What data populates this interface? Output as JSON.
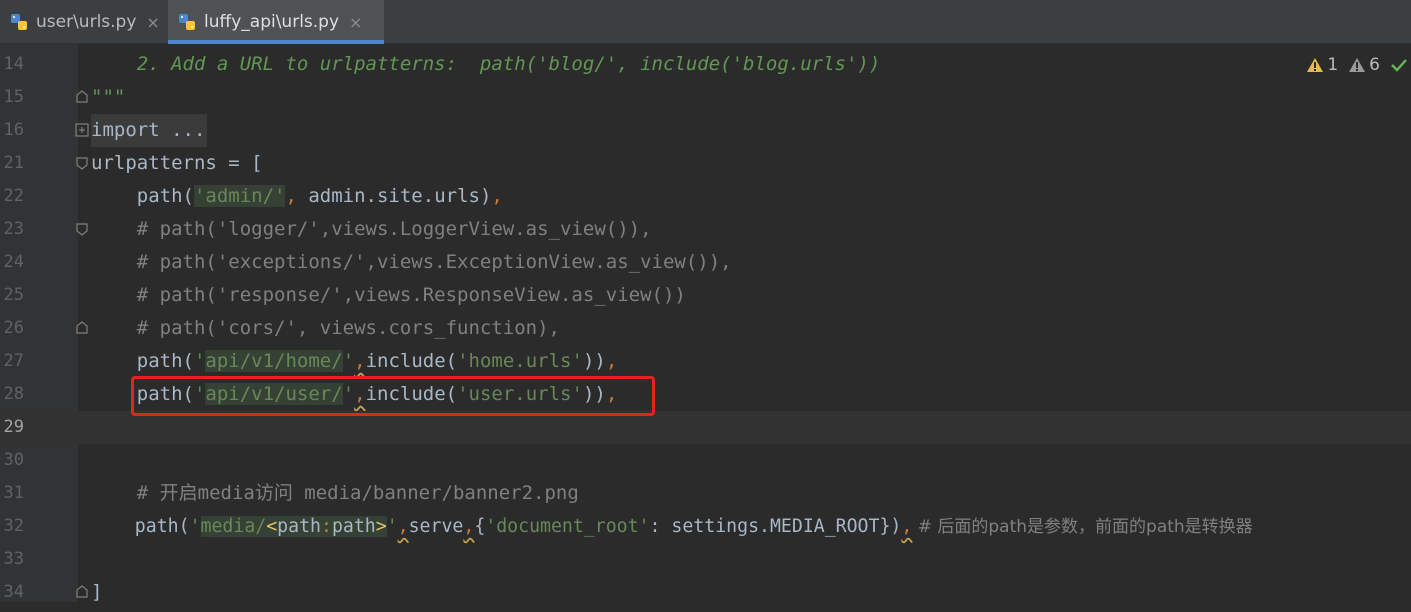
{
  "tabs": [
    {
      "label": "user\\urls.py",
      "close": "×",
      "active": false,
      "icon": "python-file-icon"
    },
    {
      "label": "luffy_api\\urls.py",
      "close": "×",
      "active": true,
      "icon": "python-file-icon"
    }
  ],
  "inspections": {
    "errors": "1",
    "warnings": "6"
  },
  "lines": [
    {
      "n": "14",
      "parts": [
        "    2. Add a URL to urlpatterns:  path('blog/', include('blog.urls'))"
      ]
    },
    {
      "n": "15",
      "parts": [
        "\"\"\""
      ]
    },
    {
      "n": "16",
      "parts": [
        "import",
        " ..."
      ]
    },
    {
      "n": "21",
      "parts": [
        "urlpatterns = ["
      ]
    },
    {
      "n": "22",
      "parts": [
        "    path(",
        "'admin/'",
        ", ",
        "admin.site.urls)",
        ","
      ]
    },
    {
      "n": "23",
      "parts": [
        "    # path('logger/',views.LoggerView.as_view()),"
      ]
    },
    {
      "n": "24",
      "parts": [
        "    # path('exceptions/',views.ExceptionView.as_view()),"
      ]
    },
    {
      "n": "25",
      "parts": [
        "    # path('response/',views.ResponseView.as_view())"
      ]
    },
    {
      "n": "26",
      "parts": [
        "    # path('cors/', views.cors_function),"
      ]
    },
    {
      "n": "27",
      "parts": [
        "    path(",
        "'",
        "api/v1/home/",
        "'",
        ",",
        "include(",
        "'home.urls'",
        "))",
        ","
      ]
    },
    {
      "n": "28",
      "parts": [
        "    path(",
        "'",
        "api/v1/user/",
        "'",
        ",",
        "include(",
        "'user.urls'",
        "))",
        ","
      ]
    },
    {
      "n": "29",
      "parts": [
        ""
      ]
    },
    {
      "n": "30",
      "parts": [
        ""
      ]
    },
    {
      "n": "31",
      "parts": [
        "    # 开启media访问 media/banner/banner2.png"
      ]
    },
    {
      "n": "32",
      "parts": [
        "    path(",
        "'",
        "media/",
        "<",
        "path",
        ":",
        "path",
        ">",
        "'",
        ",",
        "serve",
        ",",
        "{",
        "'document_root'",
        ": settings.MEDIA_ROOT})",
        ",",
        " # 后面的path是参数，前面的path是转换器"
      ]
    },
    {
      "n": "33",
      "parts": [
        ""
      ]
    },
    {
      "n": "34",
      "parts": [
        "]"
      ]
    }
  ]
}
